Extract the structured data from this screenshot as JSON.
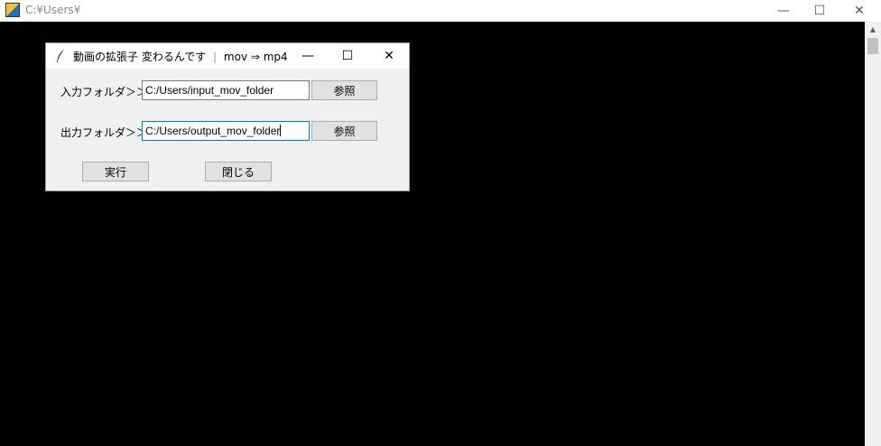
{
  "console": {
    "title": "C:¥Users¥",
    "minimize_glyph": "—",
    "maximize_glyph": "☐",
    "close_glyph": "✕"
  },
  "dialog": {
    "title_main": "動画の拡張子 変わるんです",
    "title_sep": "|",
    "title_sub": "mov ⇒ mp4",
    "minimize_glyph": "—",
    "maximize_glyph": "☐",
    "close_glyph": "✕",
    "input": {
      "label": "入力フォルダ＞＞",
      "value": "C:/Users/input_mov_folder",
      "browse_label": "参照"
    },
    "output": {
      "label": "出力フォルダ＞＞",
      "value": "C:/Users/output_mov_folder",
      "browse_label": "参照"
    },
    "run_label": "実行",
    "close_label": "閉じる"
  },
  "icons": {
    "console_app": "python-console-icon",
    "dialog_app": "tk-feather-icon"
  }
}
